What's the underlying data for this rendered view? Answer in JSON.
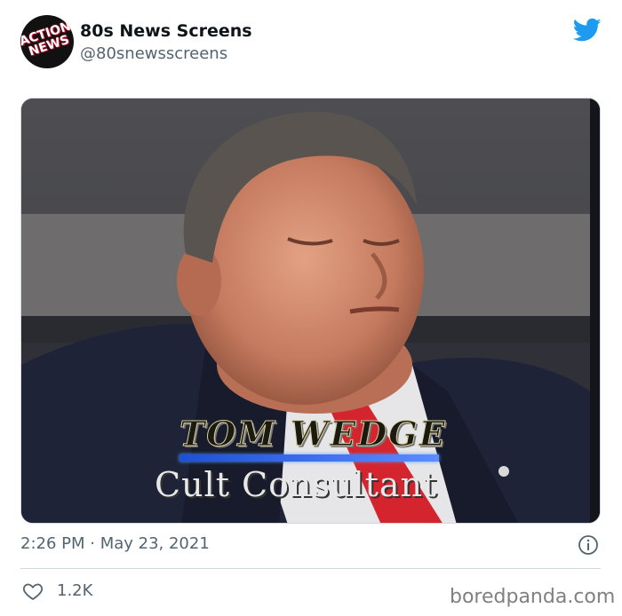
{
  "author": {
    "name": "80s News Screens",
    "handle": "@80snewsscreens",
    "avatar_text": "ACTION NEWS"
  },
  "media": {
    "lower_third_name": "TOM WEDGE",
    "lower_third_title": "Cult Consultant"
  },
  "tweet": {
    "timestamp": "2:26 PM · May 23, 2021",
    "likes": "1.2K"
  },
  "watermark": "boredpanda.com",
  "colors": {
    "twitter_blue": "#1d9bf0",
    "text_secondary": "#536471",
    "divider": "#cfd9de"
  },
  "icons": {
    "brand": "twitter-bird-icon",
    "info": "info-icon",
    "like": "heart-icon"
  }
}
